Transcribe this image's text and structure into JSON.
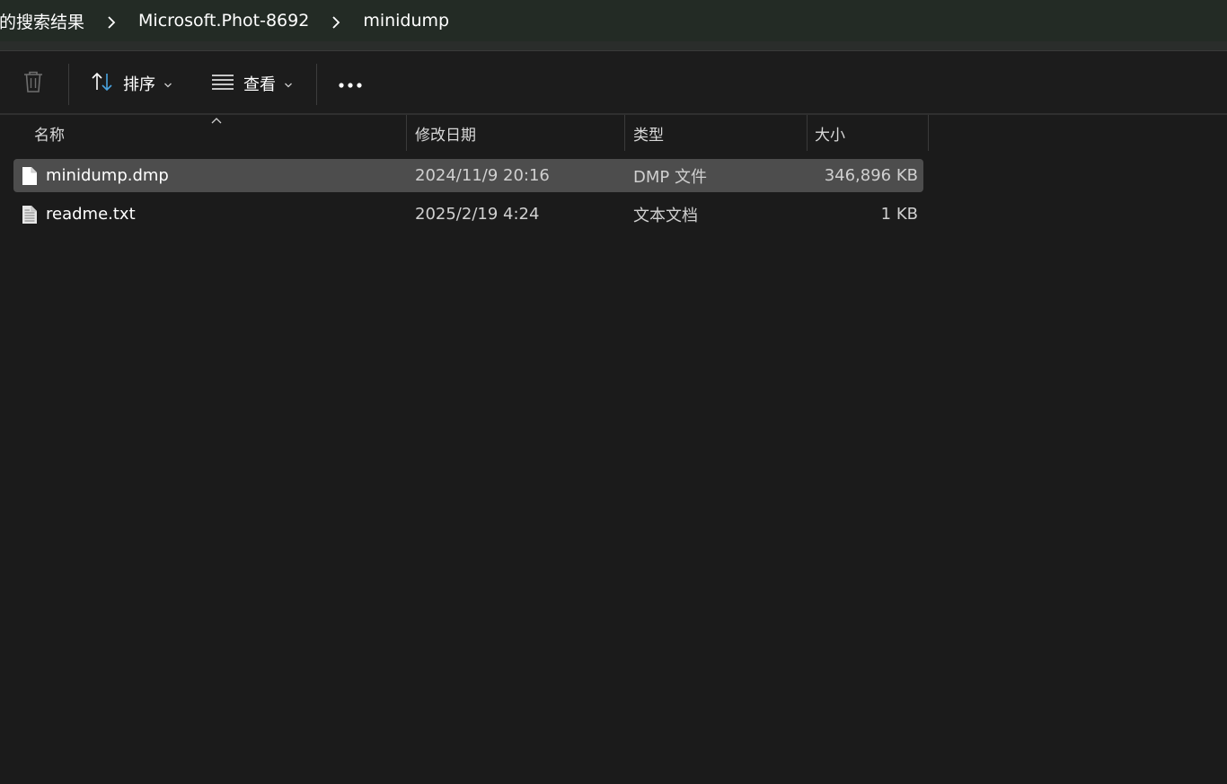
{
  "breadcrumb": {
    "items": [
      {
        "label": "的搜索结果"
      },
      {
        "label": "Microsoft.Phot-8692"
      },
      {
        "label": "minidump"
      }
    ]
  },
  "toolbar": {
    "delete_icon": "trash-icon",
    "sort_label": "排序",
    "view_label": "查看",
    "more_icon": "more-icon"
  },
  "columns": {
    "name": "名称",
    "date": "修改日期",
    "type": "类型",
    "size": "大小"
  },
  "files": [
    {
      "name": "minidump.dmp",
      "date": "2024/11/9 20:16",
      "type": "DMP 文件",
      "size": "346,896 KB",
      "selected": true,
      "icon": "blank-file-icon"
    },
    {
      "name": "readme.txt",
      "date": "2025/2/19 4:24",
      "type": "文本文档",
      "size": "1 KB",
      "selected": false,
      "icon": "text-file-icon"
    }
  ],
  "colors": {
    "background": "#1b1b1b",
    "breadcrumb_bg": "#232b25",
    "selected_row": "#4d4d4d",
    "accent": "#4aa3df"
  }
}
